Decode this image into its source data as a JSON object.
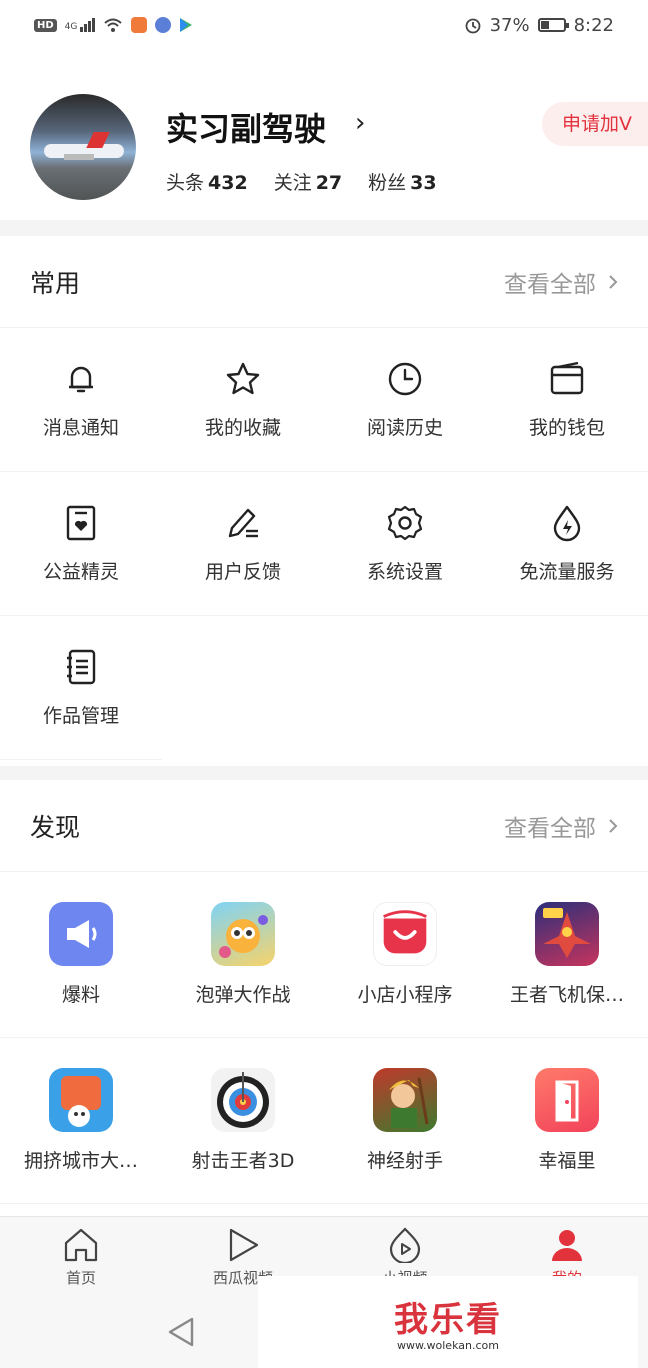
{
  "status_bar": {
    "network": "HD",
    "signal": "4G",
    "battery_percent": "37%",
    "battery_level": 0.37,
    "time": "8:22"
  },
  "profile": {
    "username": "实习副驾驶",
    "apply_v_label": "申请加V",
    "stats": [
      {
        "label": "头条",
        "value": "432"
      },
      {
        "label": "关注",
        "value": "27"
      },
      {
        "label": "粉丝",
        "value": "33"
      }
    ]
  },
  "common": {
    "title": "常用",
    "view_all": "查看全部",
    "items": [
      {
        "label": "消息通知",
        "icon": "bell-icon"
      },
      {
        "label": "我的收藏",
        "icon": "star-icon"
      },
      {
        "label": "阅读历史",
        "icon": "clock-icon"
      },
      {
        "label": "我的钱包",
        "icon": "wallet-icon"
      },
      {
        "label": "公益精灵",
        "icon": "charity-icon"
      },
      {
        "label": "用户反馈",
        "icon": "pencil-icon"
      },
      {
        "label": "系统设置",
        "icon": "gear-icon"
      },
      {
        "label": "免流量服务",
        "icon": "data-drop-icon"
      },
      {
        "label": "作品管理",
        "icon": "notebook-icon"
      }
    ]
  },
  "discover": {
    "title": "发现",
    "view_all": "查看全部",
    "items": [
      {
        "label": "爆料",
        "icon": "megaphone-app-icon"
      },
      {
        "label": "泡弹大作战",
        "icon": "bubble-game-app-icon"
      },
      {
        "label": "小店小程序",
        "icon": "shop-app-icon"
      },
      {
        "label": "王者飞机保…",
        "icon": "plane-game-app-icon"
      },
      {
        "label": "拥挤城市大…",
        "icon": "crowd-city-app-icon"
      },
      {
        "label": "射击王者3D",
        "icon": "archery-app-icon"
      },
      {
        "label": "神经射手",
        "icon": "archer-app-icon"
      },
      {
        "label": "幸福里",
        "icon": "door-app-icon"
      }
    ]
  },
  "tabbar": {
    "tabs": [
      {
        "label": "首页",
        "icon": "home-icon"
      },
      {
        "label": "西瓜视频",
        "icon": "play-icon"
      },
      {
        "label": "小视频",
        "icon": "video-drop-icon"
      },
      {
        "label": "我的",
        "icon": "person-icon"
      }
    ]
  },
  "watermark": {
    "title": "我乐看",
    "url": "www.wolekan.com"
  },
  "colors": {
    "accent": "#e2333d",
    "text": "#222222",
    "muted": "#999999"
  }
}
